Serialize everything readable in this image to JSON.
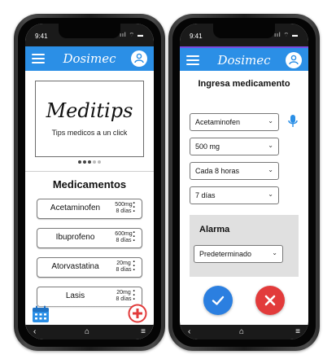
{
  "phones": {
    "left": {
      "status": {
        "time": "9:41",
        "signal": "ııl ⌔ ▬"
      },
      "app": {
        "title": "Dosimec"
      },
      "banner": {
        "title": "Meditips",
        "subtitle": "Tips medicos a un click",
        "page_index": 1,
        "page_count": 5
      },
      "section_title": "Medicamentos",
      "medications": [
        {
          "name": "Acetaminofen",
          "dose": "500mg",
          "duration": "8 días"
        },
        {
          "name": "Ibuprofeno",
          "dose": "600mg",
          "duration": "8 días"
        },
        {
          "name": "Atorvastatina",
          "dose": "20mg",
          "duration": "8 días"
        },
        {
          "name": "Lasis",
          "dose": "20mg",
          "duration": "8 días"
        }
      ]
    },
    "right": {
      "status": {
        "time": "9:41",
        "signal": "ııl ⌔ ▬"
      },
      "app": {
        "title": "Dosimec"
      },
      "form": {
        "title": "Ingresa medicamento",
        "medication": "Acetaminofen",
        "dose": "500 mg",
        "frequency": "Cada 8 horas",
        "duration": "7 días"
      },
      "alarm": {
        "title": "Alarma",
        "value": "Predeterminado"
      }
    }
  },
  "icons": {
    "menu": "hamburger-icon",
    "profile": "user-icon",
    "calendar": "calendar-icon",
    "add": "plus-icon",
    "mic": "microphone-icon",
    "confirm": "check-icon",
    "cancel": "close-icon",
    "nav_back": "chevron-left-icon",
    "nav_home": "home-icon",
    "nav_menu": "menu-icon"
  },
  "colors": {
    "appbar": "#2b8fe6",
    "accent": "#2b7fe0",
    "danger": "#e23b3b",
    "alarm_bg": "#e0e0e0"
  }
}
